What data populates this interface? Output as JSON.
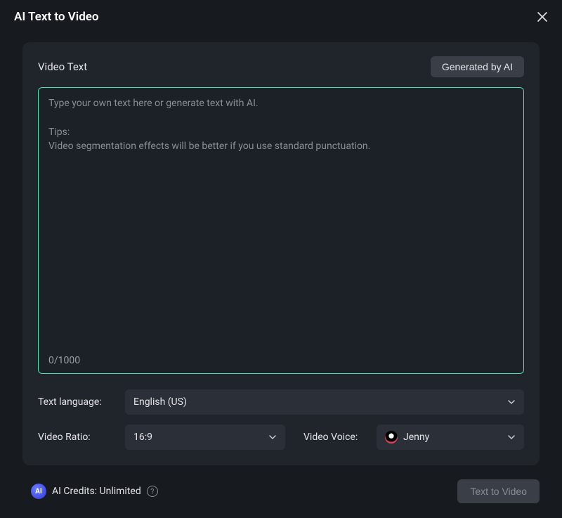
{
  "header": {
    "title": "AI Text to Video"
  },
  "panel": {
    "sectionLabel": "Video Text",
    "generateBtn": "Generated by AI",
    "placeholder": "Type your own text here or generate text with AI.\n\nTips:\nVideo segmentation effects will be better if you use standard punctuation.",
    "charCount": "0/1000"
  },
  "form": {
    "languageLabel": "Text language:",
    "languageValue": "English (US)",
    "ratioLabel": "Video Ratio:",
    "ratioValue": "16:9",
    "voiceLabel": "Video Voice:",
    "voiceValue": "Jenny"
  },
  "footer": {
    "aiBadge": "AI",
    "creditsText": "AI Credits: Unlimited",
    "submitBtn": "Text to Video"
  }
}
